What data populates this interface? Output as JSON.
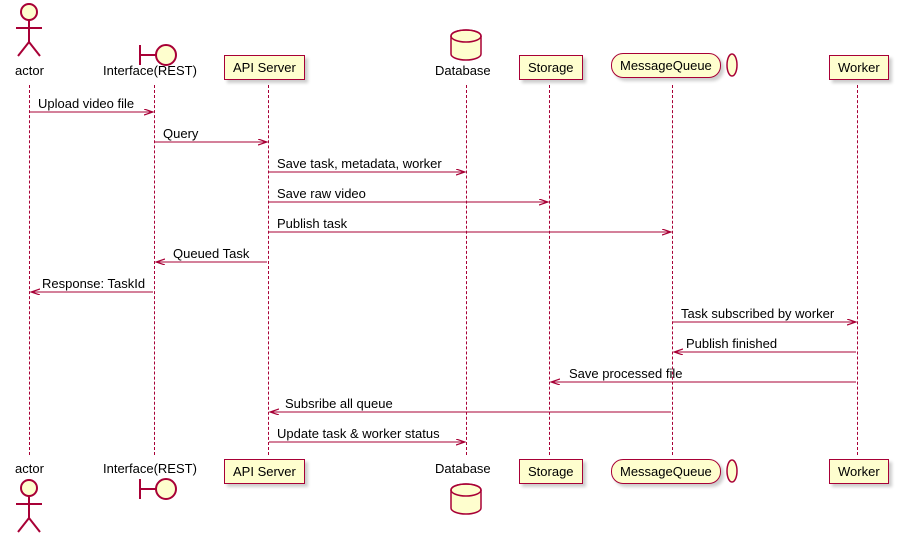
{
  "participants": {
    "actor": "actor",
    "interface": "Interface(REST)",
    "api": "API Server",
    "db": "Database",
    "storage": "Storage",
    "mq": "MessageQueue",
    "worker": "Worker"
  },
  "messages": {
    "m0": "Upload video file",
    "m1": "Query",
    "m2": "Save task, metadata, worker",
    "m3": "Save raw video",
    "m4": "Publish task",
    "m5": "Queued Task",
    "m6": "Response: TaskId",
    "m7": "Task subscribed by worker",
    "m8": "Publish finished",
    "m9": "Save processed file",
    "m10": "Subsribe all queue",
    "m11": "Update task & worker status"
  }
}
